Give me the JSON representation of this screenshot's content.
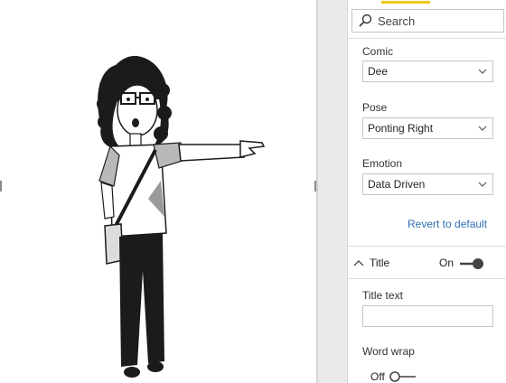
{
  "search": {
    "placeholder": "Search"
  },
  "fields": {
    "comic": {
      "label": "Comic",
      "value": "Dee"
    },
    "pose": {
      "label": "Pose",
      "value": "Ponting Right"
    },
    "emotion": {
      "label": "Emotion",
      "value": "Data Driven"
    }
  },
  "revert_label": "Revert to default",
  "title_section": {
    "title": "Title",
    "toggle_label": "On",
    "toggle_state": "on"
  },
  "title_text": {
    "label": "Title text",
    "value": ""
  },
  "word_wrap": {
    "label": "Word wrap",
    "toggle_label": "Off",
    "toggle_state": "off"
  },
  "colors": {
    "accent": "#f2c811",
    "link": "#2f6fb2",
    "toggle": "#444444"
  }
}
